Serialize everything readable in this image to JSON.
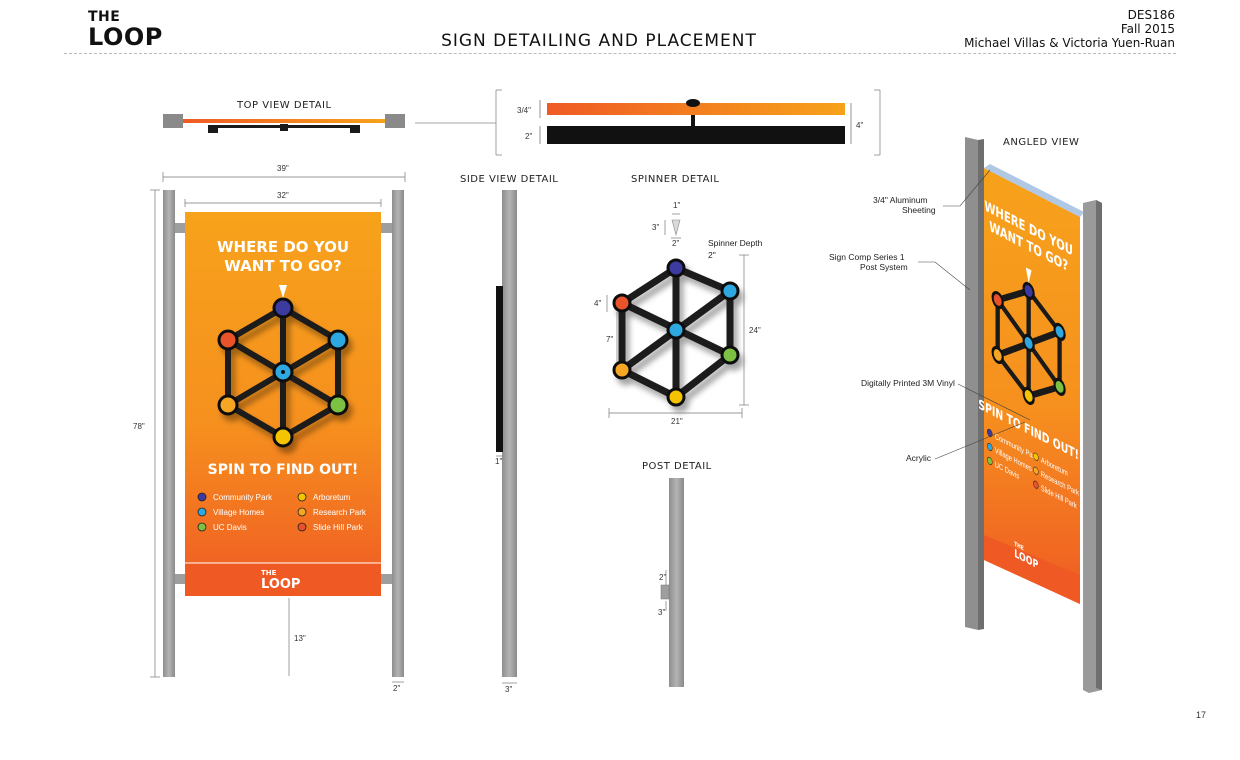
{
  "header": {
    "logo_the": "THE",
    "logo_loop": "LOOP",
    "title": "SIGN DETAILING AND PLACEMENT",
    "course": "DES186",
    "term": "Fall 2015",
    "authors": "Michael Villas & Victoria Yuen-Ruan"
  },
  "page_number": "17",
  "views": {
    "top": "TOP VIEW DETAIL",
    "side": "SIDE VIEW DETAIL",
    "spinner": "SPINNER DETAIL",
    "post": "POST DETAIL",
    "angled": "ANGLED VIEW"
  },
  "sign": {
    "headline_1": "WHERE DO YOU",
    "headline_2": "WANT TO GO?",
    "cta": "SPIN TO FIND OUT!",
    "legend_left": [
      {
        "label": "Community Park",
        "color": "#3b3aa0"
      },
      {
        "label": "Village Homes",
        "color": "#2fa8e0"
      },
      {
        "label": "UC Davis",
        "color": "#7cc142"
      }
    ],
    "legend_right": [
      {
        "label": "Arboretum",
        "color": "#f5c400"
      },
      {
        "label": "Research Park",
        "color": "#f5a623"
      },
      {
        "label": "Slide Hill Park",
        "color": "#e8522a"
      }
    ],
    "footer_the": "THE",
    "footer_loop": "LOOP"
  },
  "dimensions": {
    "overall_width": "39\"",
    "panel_width": "32\"",
    "height": "78\"",
    "clearance": "13\"",
    "post_width": "2\"",
    "side_post": "3\"",
    "side_panel": "1\"",
    "top_face": "3/4\"",
    "top_back": "2\"",
    "top_total": "4\"",
    "spinner_1": "1\"",
    "spinner_3": "3\"",
    "spinner_2": "2\"",
    "spinner_depth_label": "Spinner Depth",
    "spinner_depth": "2\"",
    "spinner_4": "4\"",
    "spinner_7": "7\"",
    "spinner_24": "24\"",
    "spinner_21": "21\"",
    "post_2": "2\"",
    "post_3": "3\""
  },
  "annotations": {
    "aluminum_1": "3/4\" Aluminum",
    "aluminum_2": "Sheeting",
    "postsys_1": "Sign Comp Series 1",
    "postsys_2": "Post System",
    "vinyl": "Digitally Printed 3M Vinyl",
    "acrylic": "Acrylic"
  },
  "colors": {
    "orange_top": "#f7a21b",
    "orange_bottom": "#ef5a24",
    "post_gray": "#a3a3a3",
    "ink": "#1a1a1a"
  }
}
